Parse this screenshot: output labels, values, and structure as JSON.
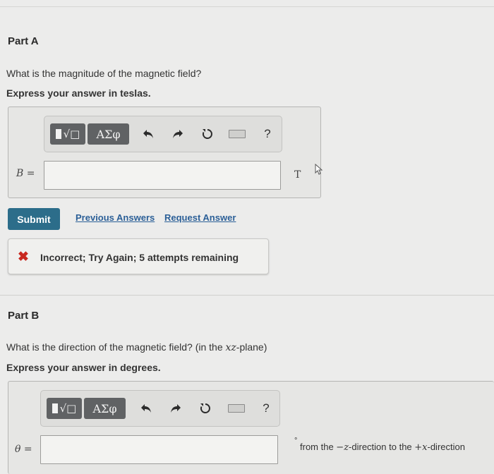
{
  "partA": {
    "title": "Part A",
    "question": "What is the magnitude of the magnetic field?",
    "instruction": "Express your answer in teslas.",
    "toolbar": {
      "templates_icon": "radical-template-icon",
      "greek_label": "ΑΣφ",
      "undo_icon": "undo-icon",
      "redo_icon": "redo-icon",
      "reset_icon": "reset-icon",
      "keyboard_icon": "keyboard-icon",
      "help_label": "?"
    },
    "variable_label": "B =",
    "answer_value": "",
    "unit": "T",
    "submit_label": "Submit",
    "previous_answers_label": "Previous Answers",
    "request_answer_label": "Request Answer",
    "feedback": {
      "icon": "x-icon",
      "message": "Incorrect; Try Again; 5 attempts remaining",
      "color": "#c8281f"
    }
  },
  "partB": {
    "title": "Part B",
    "question_prefix": "What is the direction of the magnetic field? (in the ",
    "question_math": "xz",
    "question_suffix": "-plane)",
    "instruction": "Express your answer in degrees.",
    "toolbar": {
      "greek_label": "ΑΣφ",
      "help_label": "?"
    },
    "variable_label": "θ =",
    "answer_value": "",
    "unit_degree": "°",
    "direction_from": "from the ",
    "direction_from_axis": "−z",
    "direction_mid": "-direction to the ",
    "direction_to_axis": "+x",
    "direction_end": "-direction"
  },
  "colors": {
    "submit_bg": "#2c6d8a",
    "link": "#2b5f97",
    "toolbar_button": "#606264"
  }
}
